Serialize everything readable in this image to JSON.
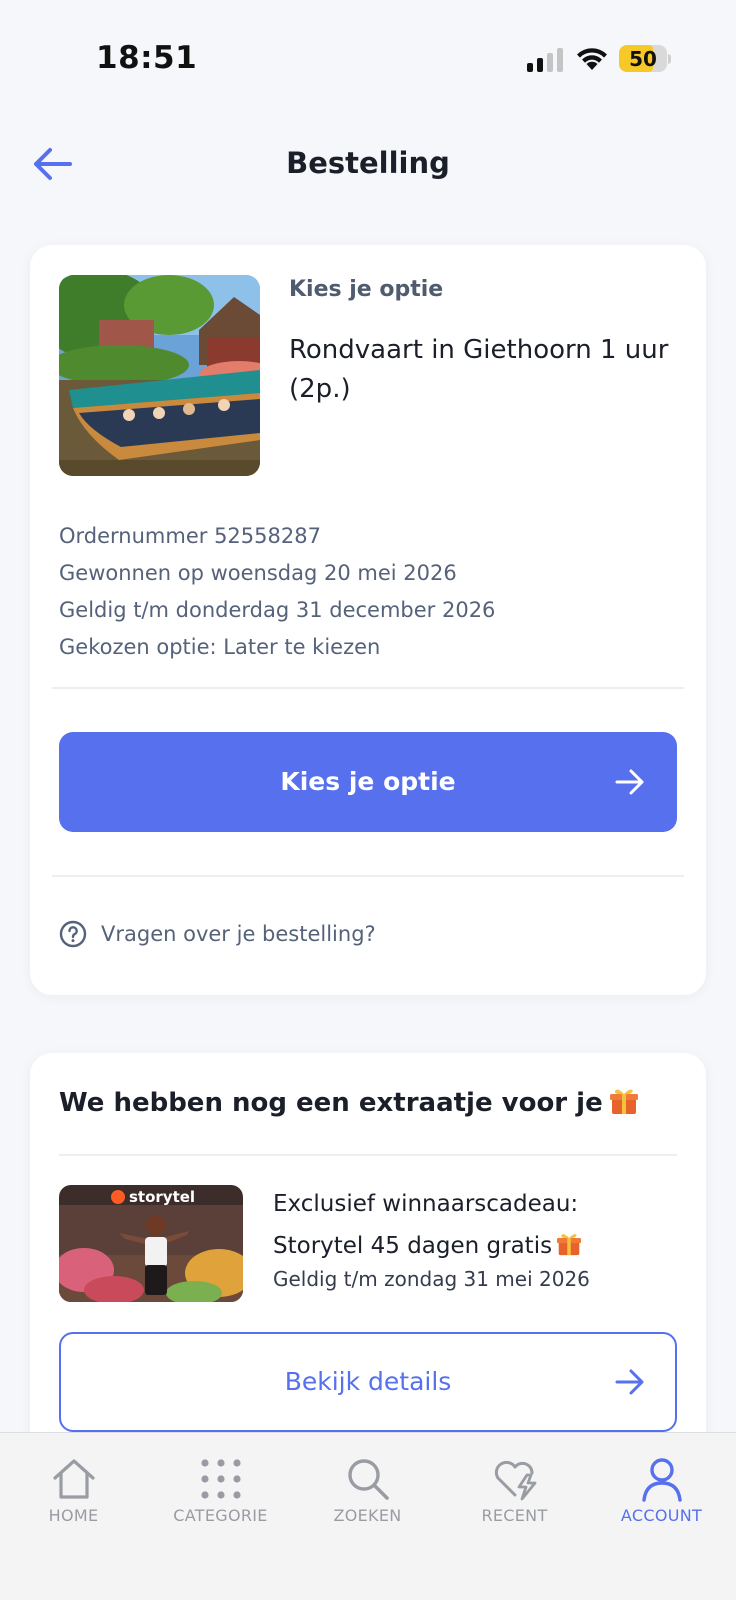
{
  "status_bar": {
    "time": "18:51",
    "battery": "50"
  },
  "header": {
    "title": "Bestelling"
  },
  "order": {
    "option_label": "Kies je optie",
    "product_title": "Rondvaart in Giethoorn 1 uur (2p.)",
    "details": [
      "Ordernummer 52558287",
      "Gewonnen op woensdag 20 mei 2026",
      "Geldig t/m donderdag 31 december 2026",
      "Gekozen optie: Later te kiezen"
    ],
    "primary_button": "Kies je optie",
    "faq_link": "Vragen over je bestelling?"
  },
  "extra": {
    "title": "We hebben nog een extraatje voor je",
    "promo_logo": "storytel",
    "promo_title_line1": "Exclusief winnaarscadeau:",
    "promo_title_line2": "Storytel 45 dagen gratis",
    "promo_valid": "Geldig t/m zondag 31 mei 2026",
    "details_button": "Bekijk details"
  },
  "bottom_nav": {
    "items": [
      {
        "label": "HOME",
        "icon": "home-icon"
      },
      {
        "label": "CATEGORIE",
        "icon": "grid-dots-icon"
      },
      {
        "label": "ZOEKEN",
        "icon": "search-icon"
      },
      {
        "label": "RECENT",
        "icon": "heart-bolt-icon"
      },
      {
        "label": "ACCOUNT",
        "icon": "user-icon"
      }
    ],
    "active": "ACCOUNT"
  },
  "colors": {
    "accent": "#5670ee",
    "muted_text": "#55627a",
    "background": "#f6f7fa"
  }
}
